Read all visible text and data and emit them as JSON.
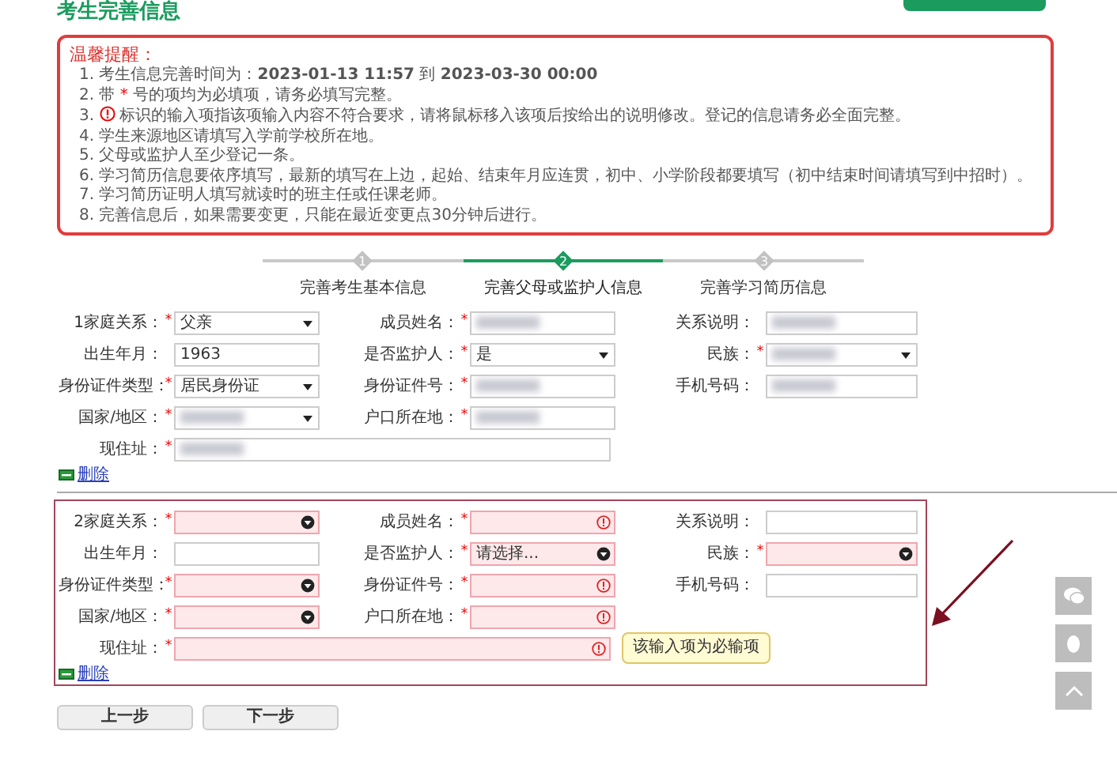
{
  "page_title": "考生完善信息",
  "notice": {
    "title": "温馨提醒：",
    "items": [
      {
        "number": "1.",
        "kind": "text",
        "text": "考生信息完善时间为：**2023-01-13 11:57** 到 **2023-03-30 00:00**"
      },
      {
        "number": "2.",
        "kind": "starred",
        "before": "带 ",
        "star": "*",
        "text": " 号的项均为必填项，请务必填写完整。"
      },
      {
        "number": "3.",
        "kind": "error-icon",
        "text": "标识的输入项指该项输入内容不符合要求，请将鼠标移入该项后按给出的说明修改。登记的信息请务必全面完整。"
      },
      {
        "number": "4.",
        "kind": "text",
        "text": "学生来源地区请填写入学前学校所在地。"
      },
      {
        "number": "5.",
        "kind": "text",
        "text": "父母或监护人至少登记一条。"
      },
      {
        "number": "6.",
        "kind": "text",
        "text": "学习简历信息要依序填写，最新的填写在上边，起始、结束年月应连贯，初中、小学阶段都要填写（初中结束时间请填写到中招时）。"
      },
      {
        "number": "7.",
        "kind": "text",
        "text": "学习简历证明人填写就读时的班主任或任课老师。"
      },
      {
        "number": "8.",
        "kind": "text",
        "text": "完善信息后，如果需要变更，只能在最近变更点30分钟后进行。"
      }
    ]
  },
  "steps": [
    {
      "number": "1",
      "label": "完善考生基本信息",
      "selected": false
    },
    {
      "number": "2",
      "label": "完善父母或监护人信息",
      "selected": true
    },
    {
      "number": "3",
      "label": "完善学习简历信息",
      "selected": false
    }
  ],
  "members": [
    {
      "invalid": false,
      "delete_label": "删除",
      "rows": [
        [
          {
            "label": "1家庭关系：",
            "star": "*",
            "kind": "select",
            "error": false,
            "value": "父亲"
          },
          {
            "label": "成员姓名：",
            "star": "*",
            "kind": "input",
            "error": false,
            "redacted": true
          },
          {
            "label": "关系说明：",
            "kind": "input",
            "error": false,
            "redacted": true
          }
        ],
        [
          {
            "label": "出生年月：",
            "kind": "input",
            "error": false,
            "value": "1963"
          },
          {
            "label": "是否监护人：",
            "star": "*",
            "kind": "select",
            "error": false,
            "value": "是"
          },
          {
            "label": "民族：",
            "star": "*",
            "kind": "select",
            "error": false,
            "redacted": true
          }
        ],
        [
          {
            "label": "身份证件类型：",
            "star": "*",
            "kind": "select",
            "error": false,
            "value": "居民身份证"
          },
          {
            "label": "身份证件号：",
            "star": "*",
            "kind": "input",
            "error": false,
            "redacted": true
          },
          {
            "label": "手机号码：",
            "kind": "input",
            "error": false,
            "redacted": true
          }
        ],
        [
          {
            "label": "国家/地区：",
            "star": "*",
            "kind": "select",
            "error": false,
            "redacted": true
          },
          {
            "label": "户口所在地：",
            "star": "*",
            "kind": "input",
            "error": false,
            "redacted": true
          }
        ],
        [
          {
            "label": "现住址：",
            "star": "*",
            "kind": "wide",
            "error": false,
            "redacted": true
          }
        ]
      ]
    },
    {
      "invalid": true,
      "delete_label": "删除",
      "rows": [
        [
          {
            "label": "2家庭关系：",
            "star": "*",
            "kind": "select",
            "error": true
          },
          {
            "label": "成员姓名：",
            "star": "*",
            "kind": "input",
            "error": true
          },
          {
            "label": "关系说明：",
            "kind": "input",
            "error": false
          }
        ],
        [
          {
            "label": "出生年月：",
            "kind": "input",
            "error": false
          },
          {
            "label": "是否监护人：",
            "star": "*",
            "kind": "select",
            "error": true,
            "value": "请选择..."
          },
          {
            "label": "民族：",
            "star": "*",
            "kind": "select",
            "error": true
          }
        ],
        [
          {
            "label": "身份证件类型：",
            "star": "*",
            "kind": "select",
            "error": true
          },
          {
            "label": "身份证件号：",
            "star": "*",
            "kind": "input",
            "error": true
          },
          {
            "label": "手机号码：",
            "kind": "input",
            "error": false
          }
        ],
        [
          {
            "label": "国家/地区：",
            "star": "*",
            "kind": "select",
            "error": true
          },
          {
            "label": "户口所在地：",
            "star": "*",
            "kind": "input",
            "error": true
          }
        ],
        [
          {
            "label": "现住址：",
            "star": "*",
            "kind": "wide",
            "error": true,
            "tooltip": "该输入项为必输项"
          }
        ]
      ]
    }
  ],
  "buttons": [
    {
      "label": "上一步"
    },
    {
      "label": "下一步"
    }
  ]
}
